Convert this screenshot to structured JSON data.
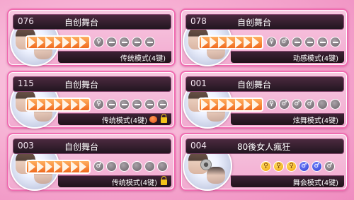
{
  "rooms": [
    {
      "number": "076",
      "name": "自创舞台",
      "mode": "传统模式(4键)",
      "slots": [
        "gf",
        "dash",
        "dash",
        "dash",
        "dash"
      ]
    },
    {
      "number": "078",
      "name": "自创舞台",
      "mode": "动感模式(4键)",
      "slots": [
        "gf",
        "gm",
        "dash",
        "dash",
        "dash",
        "dash"
      ]
    },
    {
      "number": "115",
      "name": "自创舞台",
      "mode": "传统模式(4键)",
      "slots": [
        "gf",
        "dash",
        "dash",
        "dash",
        "dash",
        "dash"
      ],
      "badges": [
        "coin-icon",
        "lock-icon"
      ]
    },
    {
      "number": "001",
      "name": "自创舞台",
      "mode": "炫舞模式(4键)",
      "slots": [
        "gf",
        "gm",
        "gm",
        "gm",
        "empty",
        "empty"
      ]
    },
    {
      "number": "003",
      "name": "自创舞台",
      "mode": "传统模式(4键)",
      "slots": [
        "gm",
        "empty",
        "empty",
        "empty",
        "empty",
        "empty"
      ],
      "badges": [
        "lock-icon"
      ]
    },
    {
      "number": "004",
      "name": "80後女人瘋狂",
      "mode": "舞会模式(4键)",
      "slots": [
        "f",
        "f",
        "f",
        "m",
        "m",
        "gm"
      ]
    }
  ],
  "symbols": {
    "female": "♀",
    "male": "♂"
  }
}
